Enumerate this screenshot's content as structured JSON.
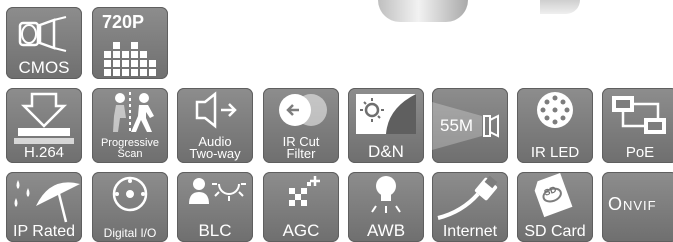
{
  "features": [
    {
      "key": "cmos",
      "label": "CMOS",
      "icon": "lens-icon"
    },
    {
      "key": "720p",
      "label": "720P",
      "icon": "pixel-grid-icon"
    },
    {
      "key": "h264",
      "label": "H.264",
      "icon": "compression-icon"
    },
    {
      "key": "progressive",
      "label": "Progressive Scan",
      "icon": "running-person-icon"
    },
    {
      "key": "audio",
      "label": "Audio Two-way",
      "icon": "speaker-icon"
    },
    {
      "key": "ircut",
      "label": "IR Cut Filter",
      "icon": "ir-filter-icon"
    },
    {
      "key": "dn",
      "label": "D&N",
      "icon": "day-night-icon"
    },
    {
      "key": "55m",
      "label": "55M",
      "icon": "ir-range-icon"
    },
    {
      "key": "irled",
      "label": "IR LED",
      "icon": "led-array-icon"
    },
    {
      "key": "poe",
      "label": "PoE",
      "icon": "network-power-icon"
    },
    {
      "key": "iprated",
      "label": "IP Rated",
      "icon": "umbrella-icon"
    },
    {
      "key": "digitalio",
      "label": "Digital I/O",
      "icon": "io-circle-icon"
    },
    {
      "key": "blc",
      "label": "BLC",
      "icon": "backlight-person-icon"
    },
    {
      "key": "agc",
      "label": "AGC",
      "icon": "gain-control-icon"
    },
    {
      "key": "awb",
      "label": "AWB",
      "icon": "bulb-icon"
    },
    {
      "key": "internet",
      "label": "Internet",
      "icon": "ethernet-cable-icon"
    },
    {
      "key": "sdcard",
      "label": "SD Card",
      "icon": "sd-card-icon"
    },
    {
      "key": "onvif",
      "label": "ONVIF",
      "icon": "onvif-logo-icon"
    }
  ],
  "labels": {
    "cmos": "CMOS",
    "p720": "720P",
    "h264": "H.264",
    "progressive_1": "Progressive",
    "progressive_2": "Scan",
    "audio_1": "Audio",
    "audio_2": "Two-way",
    "ircut_1": "IR Cut",
    "ircut_2": "Filter",
    "dn": "D&N",
    "m55": "55M",
    "irled": "IR LED",
    "poe": "PoE",
    "iprated": "IP Rated",
    "digitalio": "Digital I/O",
    "blc": "BLC",
    "agc": "AGC",
    "awb": "AWB",
    "internet": "Internet",
    "sdcard": "SD Card",
    "sd_badge": "SD",
    "onvif": "Onvif"
  },
  "colors": {
    "tile": "#7d7d7d",
    "icon": "#ffffff"
  }
}
